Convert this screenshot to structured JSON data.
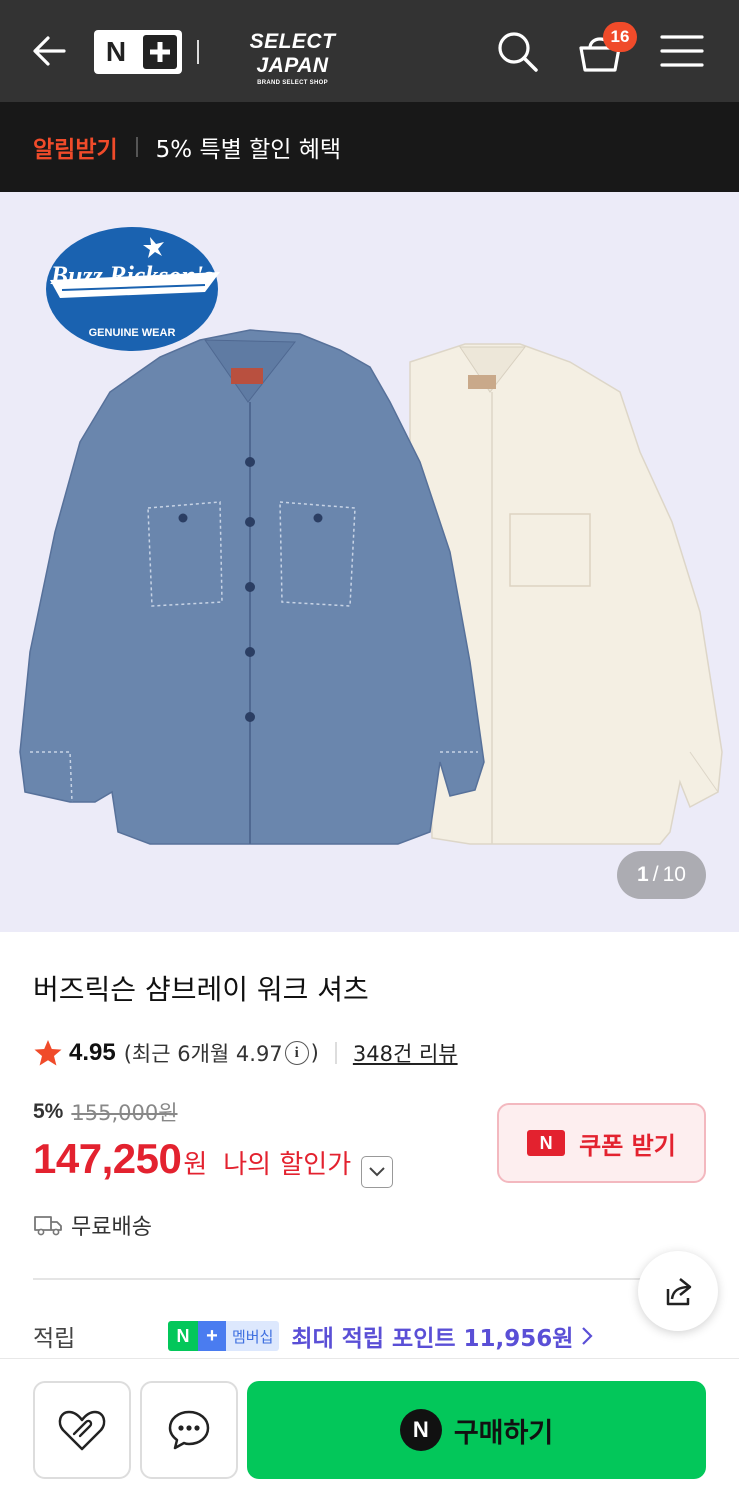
{
  "header": {
    "logo_n": "N",
    "brand_title": "SELECT JAPAN",
    "brand_subtitle": "BRAND SELECT SHOP",
    "cart_count": "16",
    "icons": [
      "back-arrow-icon",
      "search-icon",
      "cart-icon",
      "menu-icon"
    ]
  },
  "notice": {
    "alert_label": "알림받기",
    "promo_text": "5% 특별 할인 혜택"
  },
  "gallery": {
    "logo_text_1": "Buzz Rickson's",
    "logo_text_2": "GENUINE WEAR",
    "current": "1",
    "divider": "/",
    "total": "10",
    "background": "#ecebf8"
  },
  "product": {
    "title": "버즈릭슨 샴브레이 워크 셔츠",
    "rating": "4.95",
    "recent_prefix": "(최근 6개월 4.97",
    "recent_suffix": ")",
    "info_symbol": "i",
    "reviews": "348건 리뷰",
    "discount_pct": "5%",
    "original_price": "155,000원",
    "sale_price": "147,250",
    "won": "원",
    "my_price_label": "나의 할인가",
    "shipping": "무료배송"
  },
  "coupon": {
    "badge": "N",
    "label": "쿠폰 받기"
  },
  "points": {
    "label": "적립",
    "badge_n": "N",
    "badge_plus": "+",
    "badge_text": "멤버십",
    "text": "최대 적립 포인트 11,956원"
  },
  "bottom": {
    "buy_badge": "N",
    "buy_label": "구매하기"
  },
  "colors": {
    "accent_green": "#03c75a",
    "price_red": "#e3222f",
    "alert_orange": "#f04b2a",
    "points_purple": "#5a4fd6"
  }
}
